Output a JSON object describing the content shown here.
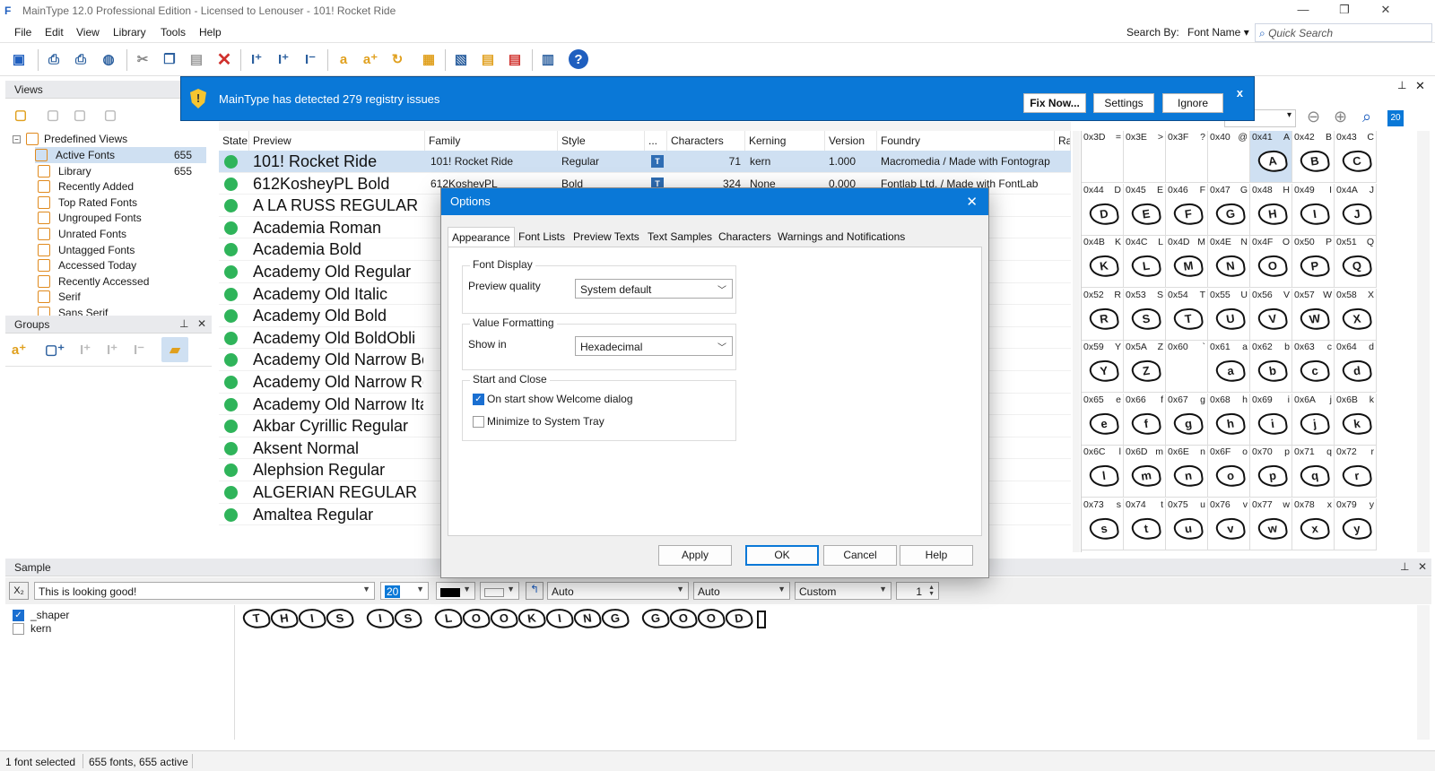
{
  "window": {
    "title": "MainType 12.0 Professional Edition - Licensed to Lenouser - 101! Rocket Ride"
  },
  "menu": [
    "File",
    "Edit",
    "View",
    "Library",
    "Tools",
    "Help"
  ],
  "search": {
    "label": "Search By:",
    "field": "Font Name",
    "placeholder": "Quick Search"
  },
  "notification": {
    "message": "MainType has detected 279 registry issues",
    "fix": "Fix Now...",
    "settings": "Settings",
    "ignore": "Ignore"
  },
  "views": {
    "header": "Views",
    "root": "Predefined Views",
    "items": [
      {
        "label": "Active Fonts",
        "count": "655"
      },
      {
        "label": "Library",
        "count": "655"
      },
      {
        "label": "Recently Added",
        "count": ""
      },
      {
        "label": "Top Rated Fonts",
        "count": ""
      },
      {
        "label": "Ungrouped Fonts",
        "count": ""
      },
      {
        "label": "Unrated Fonts",
        "count": ""
      },
      {
        "label": "Untagged Fonts",
        "count": ""
      },
      {
        "label": "Accessed Today",
        "count": ""
      },
      {
        "label": "Recently Accessed",
        "count": ""
      },
      {
        "label": "Serif",
        "count": ""
      },
      {
        "label": "Sans Serif",
        "count": ""
      }
    ]
  },
  "groups": {
    "header": "Groups"
  },
  "grid": {
    "columns": [
      "State",
      "Preview",
      "Family",
      "Style",
      "...",
      "Characters",
      "Kerning",
      "Version",
      "Foundry",
      "Rat"
    ],
    "rows": [
      {
        "preview": "101! Rocket Ride",
        "family": "101! Rocket Ride",
        "style": "Regular",
        "chars": "71",
        "kern": "kern",
        "version": "1.000",
        "foundry": "Macromedia / Made with Fontograp"
      },
      {
        "preview": "612KosheyPL Bold",
        "family": "612KosheyPL",
        "style": "Bold",
        "chars": "324",
        "kern": "None",
        "version": "0.000",
        "foundry": "Fontlab Ltd. / Made with FontLab"
      },
      {
        "preview": "A LA RUSS REGULAR",
        "family": "",
        "style": "",
        "chars": "",
        "kern": "",
        "version": "",
        "foundry": ""
      },
      {
        "preview": "Academia Roman",
        "family": "",
        "style": "",
        "chars": "",
        "kern": "",
        "version": "",
        "foundry": ""
      },
      {
        "preview": "Academia Bold",
        "family": "",
        "style": "",
        "chars": "",
        "kern": "",
        "version": "",
        "foundry": ""
      },
      {
        "preview": "Academy Old Regular",
        "family": "",
        "style": "",
        "chars": "",
        "kern": "",
        "version": "",
        "foundry": ""
      },
      {
        "preview": "Academy Old Italic",
        "family": "",
        "style": "",
        "chars": "",
        "kern": "",
        "version": "",
        "foundry": ""
      },
      {
        "preview": "Academy Old Bold",
        "family": "",
        "style": "",
        "chars": "",
        "kern": "",
        "version": "",
        "foundry": ""
      },
      {
        "preview": "Academy Old BoldObli",
        "family": "",
        "style": "",
        "chars": "",
        "kern": "",
        "version": "",
        "foundry": "ith FontForge"
      },
      {
        "preview": "Academy Old Narrow Bold",
        "family": "",
        "style": "",
        "chars": "",
        "kern": "",
        "version": "",
        "foundry": "ith FontForge"
      },
      {
        "preview": "Academy Old Narrow Regular",
        "family": "",
        "style": "",
        "chars": "",
        "kern": "",
        "version": "",
        "foundry": ""
      },
      {
        "preview": "Academy Old Narrow Italic",
        "family": "",
        "style": "",
        "chars": "",
        "kern": "",
        "version": "",
        "foundry": ""
      },
      {
        "preview": "Akbar Cyrillic Regular",
        "family": "",
        "style": "",
        "chars": "",
        "kern": "",
        "version": "",
        "foundry": ""
      },
      {
        "preview": "Aksent Normal",
        "family": "",
        "style": "",
        "chars": "",
        "kern": "",
        "version": "",
        "foundry": "ontographer"
      },
      {
        "preview": "Alephsion Regular",
        "family": "",
        "style": "",
        "chars": "",
        "kern": "",
        "version": "",
        "foundry": ""
      },
      {
        "preview": "ALGERIAN REGULAR",
        "family": "",
        "style": "",
        "chars": "",
        "kern": "",
        "version": "",
        "foundry": "e with Fontograp"
      },
      {
        "preview": "Amaltea Regular",
        "family": "",
        "style": "",
        "chars": "",
        "kern": "",
        "version": "",
        "foundry": "with FontLab"
      }
    ]
  },
  "charmap": {
    "cells": [
      [
        "0x3D",
        "="
      ],
      [
        "0x3E",
        ">"
      ],
      [
        "0x3F",
        "?"
      ],
      [
        "0x40",
        "@"
      ],
      [
        "0x41",
        "A"
      ],
      [
        "0x42",
        "B"
      ],
      [
        "0x43",
        "C"
      ],
      [
        "0x44",
        "D"
      ],
      [
        "0x45",
        "E"
      ],
      [
        "0x46",
        "F"
      ],
      [
        "0x47",
        "G"
      ],
      [
        "0x48",
        "H"
      ],
      [
        "0x49",
        "I"
      ],
      [
        "0x4A",
        "J"
      ],
      [
        "0x4B",
        "K"
      ],
      [
        "0x4C",
        "L"
      ],
      [
        "0x4D",
        "M"
      ],
      [
        "0x4E",
        "N"
      ],
      [
        "0x4F",
        "O"
      ],
      [
        "0x50",
        "P"
      ],
      [
        "0x51",
        "Q"
      ],
      [
        "0x52",
        "R"
      ],
      [
        "0x53",
        "S"
      ],
      [
        "0x54",
        "T"
      ],
      [
        "0x55",
        "U"
      ],
      [
        "0x56",
        "V"
      ],
      [
        "0x57",
        "W"
      ],
      [
        "0x58",
        "X"
      ],
      [
        "0x59",
        "Y"
      ],
      [
        "0x5A",
        "Z"
      ],
      [
        "0x60",
        "`"
      ],
      [
        "0x61",
        "a"
      ],
      [
        "0x62",
        "b"
      ],
      [
        "0x63",
        "c"
      ],
      [
        "0x64",
        "d"
      ],
      [
        "0x65",
        "e"
      ],
      [
        "0x66",
        "f"
      ],
      [
        "0x67",
        "g"
      ],
      [
        "0x68",
        "h"
      ],
      [
        "0x69",
        "i"
      ],
      [
        "0x6A",
        "j"
      ],
      [
        "0x6B",
        "k"
      ],
      [
        "0x6C",
        "l"
      ],
      [
        "0x6D",
        "m"
      ],
      [
        "0x6E",
        "n"
      ],
      [
        "0x6F",
        "o"
      ],
      [
        "0x70",
        "p"
      ],
      [
        "0x71",
        "q"
      ],
      [
        "0x72",
        "r"
      ],
      [
        "0x73",
        "s"
      ],
      [
        "0x74",
        "t"
      ],
      [
        "0x75",
        "u"
      ],
      [
        "0x76",
        "v"
      ],
      [
        "0x77",
        "w"
      ],
      [
        "0x78",
        "x"
      ],
      [
        "0x79",
        "y"
      ]
    ],
    "selected": "0x41",
    "zoom": "20"
  },
  "sample": {
    "header": "Sample",
    "text": "This is looking good!",
    "size": "20",
    "opt1": "Auto",
    "opt2": "Auto",
    "opt3": "Custom",
    "lines": "1",
    "features": [
      {
        "label": "_shaper",
        "checked": true
      },
      {
        "label": "kern",
        "checked": false
      }
    ],
    "rendered": "THIS IS LOOKING GOOD"
  },
  "dialog": {
    "title": "Options",
    "tabs": [
      "Appearance",
      "Font Lists",
      "Preview Texts",
      "Text Samples",
      "Characters",
      "Warnings and Notifications"
    ],
    "font_display": {
      "label": "Font Display",
      "field_label": "Preview quality",
      "value": "System default"
    },
    "value_formatting": {
      "label": "Value Formatting",
      "field_label": "Show in",
      "value": "Hexadecimal"
    },
    "start_close": {
      "label": "Start and Close",
      "welcome": "On start show Welcome dialog",
      "tray": "Minimize to System Tray"
    },
    "buttons": {
      "apply": "Apply",
      "ok": "OK",
      "cancel": "Cancel",
      "help": "Help"
    }
  },
  "status": {
    "selected": "1 font selected",
    "summary": "655 fonts, 655 active"
  },
  "colors": {
    "accent": "#0a78d7",
    "active_state": "#2fb45a",
    "selection": "#cfe0f2"
  }
}
